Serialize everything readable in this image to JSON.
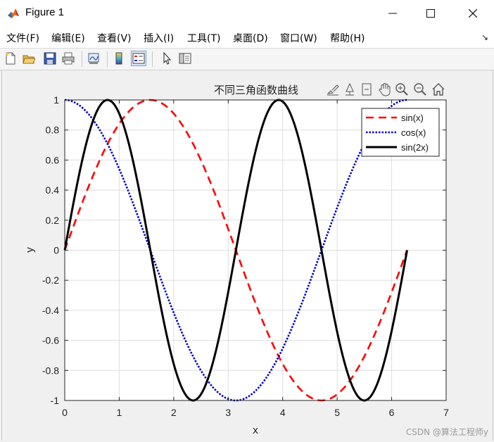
{
  "window": {
    "title": "Figure 1",
    "minimize": "—",
    "maximize": "☐",
    "close": "✕"
  },
  "menu": {
    "items": [
      "文件(F)",
      "编辑(E)",
      "查看(V)",
      "插入(I)",
      "工具(T)",
      "桌面(D)",
      "窗口(W)",
      "帮助(H)"
    ],
    "overflow_icon": "↘"
  },
  "toolbar": {
    "icons": [
      "new-figure-icon",
      "open-file-icon",
      "save-icon",
      "print-icon",
      "link-plot-icon",
      "colorbar-icon",
      "legend-icon",
      "edit-plot-icon",
      "property-inspector-icon"
    ]
  },
  "axes_toolbar": {
    "icons": [
      "brush-icon",
      "data-tips-icon",
      "rotate-icon",
      "pan-icon",
      "zoom-in-icon",
      "zoom-out-icon",
      "home-icon"
    ]
  },
  "chart_data": {
    "type": "line",
    "title": "不同三角函数曲线",
    "xlabel": "x",
    "ylabel": "y",
    "xlim": [
      0,
      7
    ],
    "ylim": [
      -1,
      1
    ],
    "xticks": [
      0,
      1,
      2,
      3,
      4,
      5,
      6,
      7
    ],
    "yticks": [
      -1,
      -0.8,
      -0.6,
      -0.4,
      -0.2,
      0,
      0.2,
      0.4,
      0.6,
      0.8,
      1
    ],
    "ytick_labels": [
      "-1",
      "-0.8",
      "-0.6",
      "-0.4",
      "-0.2",
      "0",
      "0.2",
      "0.4",
      "0.6",
      "0.8",
      "1"
    ],
    "grid": true,
    "legend_position": "top-right",
    "x_range": [
      0,
      6.2832
    ],
    "series": [
      {
        "name": "sin(x)",
        "function": "sin(x)",
        "color": "#ff0000",
        "style": "dashed"
      },
      {
        "name": "cos(x)",
        "function": "cos(x)",
        "color": "#0000cc",
        "style": "dotted"
      },
      {
        "name": "sin(2x)",
        "function": "sin(2x)",
        "color": "#000000",
        "style": "solid"
      }
    ]
  },
  "watermark": "CSDN @算法工程师y"
}
